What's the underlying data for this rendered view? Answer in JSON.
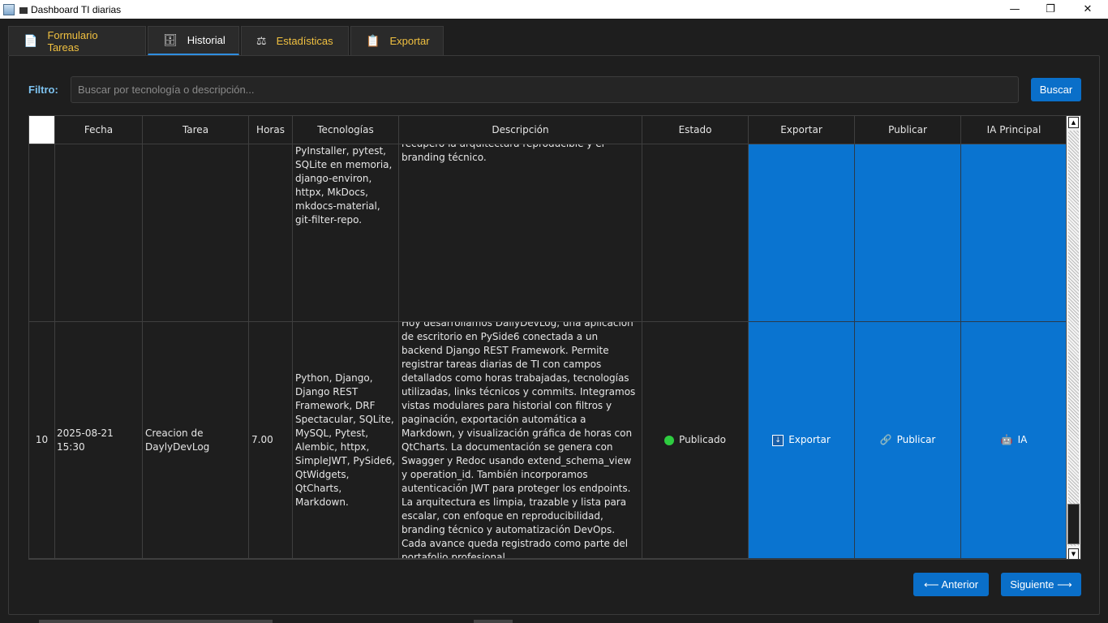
{
  "window": {
    "title": "Dashboard TI diarias",
    "min": "—",
    "restore": "❐",
    "close": "✕"
  },
  "tabs": [
    {
      "label": "Formulario Tareas",
      "icon": "📄"
    },
    {
      "label": "Historial",
      "icon": "🗄"
    },
    {
      "label": "Estadísticas",
      "icon": "⚖"
    },
    {
      "label": "Exportar",
      "icon": "📋"
    }
  ],
  "filter": {
    "label": "Filtro:",
    "placeholder": "Buscar por tecnología o descripción...",
    "button": "Buscar"
  },
  "table": {
    "headers": [
      "Fecha",
      "Tarea",
      "Horas",
      "Tecnologías",
      "Descripción",
      "Estado",
      "Exportar",
      "Publicar",
      "IA Principal"
    ],
    "partial_row": {
      "tech": "PyInstaller, pytest, SQLite en memoria, django-environ, httpx, MkDocs, mkdocs-material, git-filter-repo.",
      "desc_top": "recupero la arquitectura reproducible y el",
      "desc": "branding técnico."
    },
    "row": {
      "num": "10",
      "fecha": "2025-08-21 15:30",
      "tarea": "Creacion de DaylyDevLog",
      "horas": "7.00",
      "tech": "Python, Django, Django REST Framework, DRF Spectacular, SQLite, MySQL, Pytest, Alembic, httpx, SimpleJWT, PySide6, QtWidgets, QtCharts, Markdown.",
      "desc": "Hoy desarrollamos DailyDevLog, una aplicación de escritorio en PySide6 conectada a un backend Django REST Framework. Permite registrar tareas diarias de TI con campos detallados como horas trabajadas, tecnologías utilizadas, links técnicos y commits. Integramos vistas modulares para historial con filtros y paginación, exportación automática a Markdown, y visualización gráfica de horas con QtCharts. La documentación se genera con Swagger y Redoc usando extend_schema_view y operation_id. También incorporamos autenticación JWT para proteger los endpoints. La arquitectura es limpia, trazable y lista para escalar, con enfoque en reproducibilidad, branding técnico y automatización DevOps. Cada avance queda registrado como parte del portafolio profesional.",
      "estado": "Publicado",
      "exportar": "Exportar",
      "publicar": "Publicar",
      "ia": "IA"
    }
  },
  "pagination": {
    "prev": "⟵ Anterior",
    "next": "Siguiente ⟶"
  },
  "colors": {
    "accent": "#0a74d0",
    "status_ok": "#2ecc40",
    "tab_text": "#f0c040",
    "filter_label": "#7ec3f0"
  }
}
